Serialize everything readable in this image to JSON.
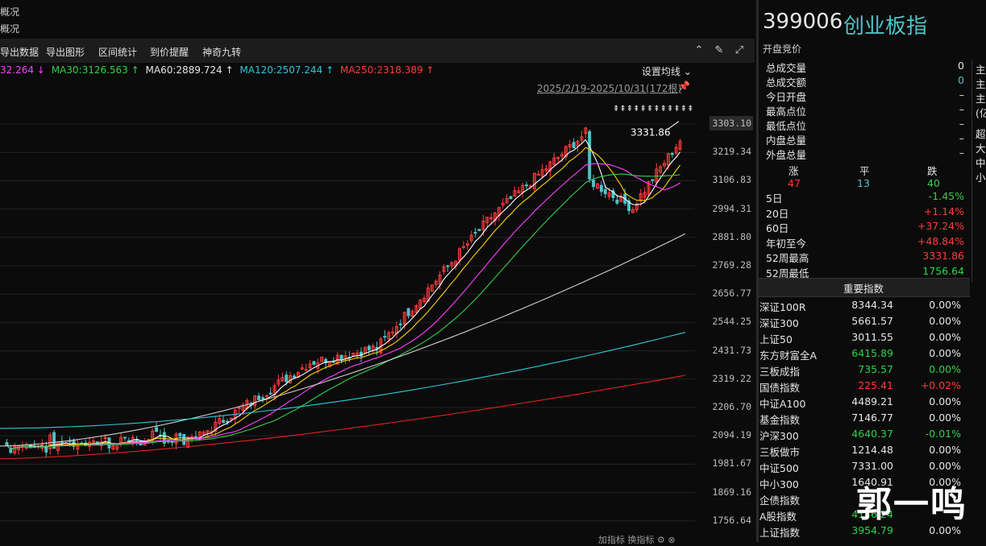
{
  "tabs": [
    "概况",
    "概况"
  ],
  "toolbar": {
    "items": [
      "导出数据",
      "导出图形",
      "区间统计",
      "到价提醒",
      "神奇九转"
    ],
    "icons": [
      "circle-up-icon",
      "brush-icon",
      "settings-icon",
      "expand-icon"
    ]
  },
  "ma": {
    "ma_first": "32.264 ↓",
    "ma30": "MA30:3126.563 ↑",
    "ma60": "MA60:2889.724 ↑",
    "ma120": "MA120:2507.244 ↑",
    "ma250": "MA250:2318.389 ↑",
    "colors": {
      "ma5": "#ff40ff",
      "ma30": "#2fd14a",
      "ma60": "#e6e6e6",
      "ma120": "#2ec8d8",
      "ma250": "#ff3b3b"
    }
  },
  "set_ma": "设置均线 ⌄",
  "range": "2025/2/19-2025/10/31(172根)",
  "arrows_marker": "⇞⇞⇞⇞⇞⇞⇞⇞⇞⇞⇞⇞⇞",
  "chart_data": {
    "type": "candlestick",
    "high_label": "3331.86",
    "y_ticks": [
      "3303.10",
      "3219.34",
      "3106.83",
      "2994.31",
      "2881.80",
      "2769.28",
      "2656.77",
      "2544.25",
      "2431.73",
      "2319.22",
      "2206.70",
      "2094.19",
      "1981.67",
      "1869.16",
      "1756.64"
    ],
    "ylim": [
      1756.64,
      3331.86
    ],
    "colors": {
      "up": "#ff3b3b",
      "down": "#4fc3c8"
    }
  },
  "bottom_bar": "加指标  换指标  ⚙  ⊗",
  "stock": {
    "code": "399006",
    "name": "创业板指",
    "status": "开盘竞价"
  },
  "stats": [
    {
      "label": "总成交量",
      "value": "0",
      "color": "white"
    },
    {
      "label": "总成交额",
      "value": "0",
      "color": "cyan"
    },
    {
      "label": "今日开盘",
      "value": "–",
      "color": "white"
    },
    {
      "label": "最高点位",
      "value": "–",
      "color": "white"
    },
    {
      "label": "最低点位",
      "value": "–",
      "color": "white"
    },
    {
      "label": "内盘总量",
      "value": "–",
      "color": "white"
    },
    {
      "label": "外盘总量",
      "value": "–",
      "color": "white"
    }
  ],
  "breadth": {
    "up_label": "涨",
    "flat_label": "平",
    "down_label": "跌",
    "up": "47",
    "flat": "13",
    "down": "40"
  },
  "perf": [
    {
      "label": "5日",
      "value": "-1.45%",
      "color": "green"
    },
    {
      "label": "20日",
      "value": "+1.14%",
      "color": "red"
    },
    {
      "label": "60日",
      "value": "+37.24%",
      "color": "red"
    },
    {
      "label": "年初至今",
      "value": "+48.84%",
      "color": "red"
    },
    {
      "label": "52周最高",
      "value": "3331.86",
      "color": "red"
    },
    {
      "label": "52周最低",
      "value": "1756.64",
      "color": "green"
    }
  ],
  "index_title": "重要指数",
  "indices": [
    {
      "name": "深证100R",
      "value": "8344.34",
      "change": "0.00%",
      "vcolor": "white",
      "ccolor": "white"
    },
    {
      "name": "深证300",
      "value": "5661.57",
      "change": "0.00%",
      "vcolor": "white",
      "ccolor": "white"
    },
    {
      "name": "上证50",
      "value": "3011.55",
      "change": "0.00%",
      "vcolor": "white",
      "ccolor": "white"
    },
    {
      "name": "东方财富全A",
      "value": "6415.89",
      "change": "0.00%",
      "vcolor": "green",
      "ccolor": "white"
    },
    {
      "name": "三板成指",
      "value": "735.57",
      "change": "0.00%",
      "vcolor": "green",
      "ccolor": "green"
    },
    {
      "name": "国债指数",
      "value": "225.41",
      "change": "+0.02%",
      "vcolor": "red",
      "ccolor": "red"
    },
    {
      "name": "中证A100",
      "value": "4489.21",
      "change": "0.00%",
      "vcolor": "white",
      "ccolor": "white"
    },
    {
      "name": "基金指数",
      "value": "7146.77",
      "change": "0.00%",
      "vcolor": "white",
      "ccolor": "white"
    },
    {
      "name": "沪深300",
      "value": "4640.37",
      "change": "-0.01%",
      "vcolor": "green",
      "ccolor": "green"
    },
    {
      "name": "三板做市",
      "value": "1214.48",
      "change": "0.00%",
      "vcolor": "white",
      "ccolor": "white"
    },
    {
      "name": "中证500",
      "value": "7331.00",
      "change": "0.00%",
      "vcolor": "white",
      "ccolor": "white"
    },
    {
      "name": "中小300",
      "value": "1640.91",
      "change": "0.00%",
      "vcolor": "white",
      "ccolor": "white"
    },
    {
      "name": "企债指数",
      "value": "",
      "change": "",
      "vcolor": "white",
      "ccolor": "white"
    },
    {
      "name": "A股指数",
      "value": "4146.24",
      "change": "",
      "vcolor": "green",
      "ccolor": "white"
    },
    {
      "name": "上证指数",
      "value": "3954.79",
      "change": "0.00%",
      "vcolor": "green",
      "ccolor": "white"
    }
  ],
  "far_right": [
    "主",
    "主",
    "主",
    "(亿",
    "超",
    "大",
    "中",
    "小"
  ],
  "watermark": "郭一鸣"
}
